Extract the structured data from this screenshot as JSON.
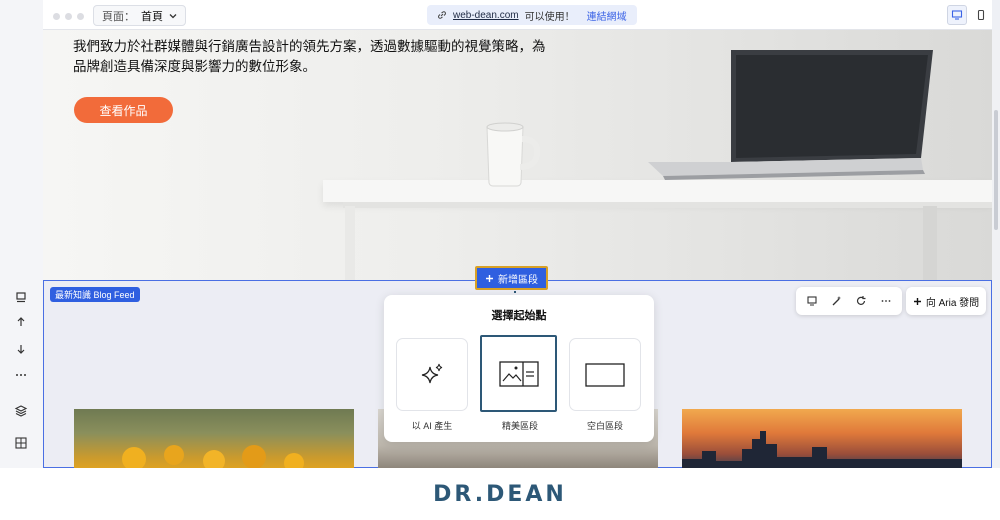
{
  "topbar": {
    "page_label": "頁面：",
    "page_value": "首頁",
    "url_domain": "web-dean.com",
    "url_status": "可以使用！",
    "url_connect": "連結網域"
  },
  "hero": {
    "text": "我們致力於社群媒體與行銷廣告設計的領先方案，透過數據驅動的視覺策略，為品牌創造具備深度與影響力的數位形象。",
    "button": "查看作品"
  },
  "blog": {
    "badge": "最新知識 Blog Feed",
    "add_section": "新增區段",
    "ask_aria": "向 Aria 發問"
  },
  "popup": {
    "title": "選擇起始點",
    "options": [
      {
        "label": "以 AI 產生",
        "icon": "sparkles-icon"
      },
      {
        "label": "精美區段",
        "icon": "image-text-icon"
      },
      {
        "label": "空白區段",
        "icon": "blank-rect-icon"
      }
    ]
  },
  "footer": {
    "logo": "DR.DEAN"
  },
  "colors": {
    "accent": "#2f5fe0",
    "cta": "#f26b3a",
    "highlight": "#d8a126",
    "brand": "#2d5877"
  }
}
